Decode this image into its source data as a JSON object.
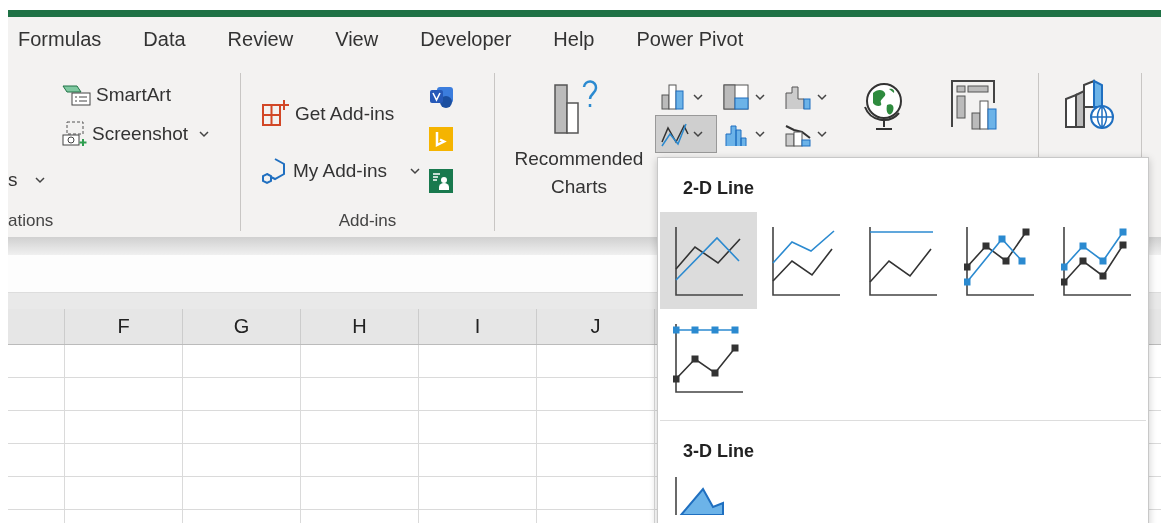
{
  "tabs": [
    "Formulas",
    "Data",
    "Review",
    "View",
    "Developer",
    "Help",
    "Power Pivot"
  ],
  "illustrations": {
    "partial_button": "s",
    "smartart": "SmartArt",
    "screenshot": "Screenshot",
    "group_label": "ations"
  },
  "addins": {
    "get": "Get Add-ins",
    "my": "My Add-ins",
    "group_label": "Add-ins"
  },
  "charts": {
    "recommended": "Recommended Charts",
    "chart_buttons": [
      {
        "kind": "column",
        "selected": false
      },
      {
        "kind": "hierarchy",
        "selected": false
      },
      {
        "kind": "waterfall",
        "selected": false
      },
      {
        "kind": "line",
        "selected": true
      },
      {
        "kind": "statistic",
        "selected": false
      },
      {
        "kind": "combo",
        "selected": false
      }
    ]
  },
  "columns": [
    "F",
    "G",
    "H",
    "I",
    "J"
  ],
  "line_menu": {
    "sections": [
      {
        "title": "2-D Line",
        "items": [
          {
            "kind": "line",
            "selected": true
          },
          {
            "kind": "stacked_line",
            "selected": false
          },
          {
            "kind": "stacked_100_line",
            "selected": false
          },
          {
            "kind": "line_markers",
            "selected": false
          },
          {
            "kind": "stacked_line_markers",
            "selected": false
          },
          {
            "kind": "stacked_100_line_markers",
            "selected": false
          }
        ]
      },
      {
        "title": "3-D Line",
        "items": [
          {
            "kind": "line_3d",
            "selected": false
          }
        ]
      }
    ]
  }
}
